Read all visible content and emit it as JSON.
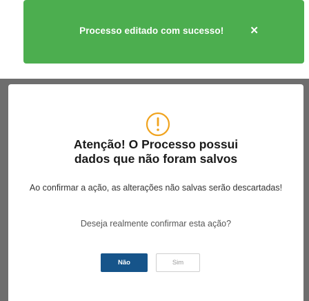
{
  "toast": {
    "message": "Processo editado com sucesso!",
    "close": "✕",
    "color": "#4cae4f"
  },
  "dialog": {
    "icon": "warning-circle-icon",
    "icon_color": "#f0a31e",
    "title_line1": "Atenção! O Processo possui",
    "title_line2": "dados que não foram salvos",
    "body": "Ao confirmar a ação, as alterações não salvas serão descartadas!",
    "question": "Deseja realmente confirmar esta ação?",
    "no_label": "Não",
    "yes_label": "Sim",
    "primary_color": "#16548a"
  }
}
